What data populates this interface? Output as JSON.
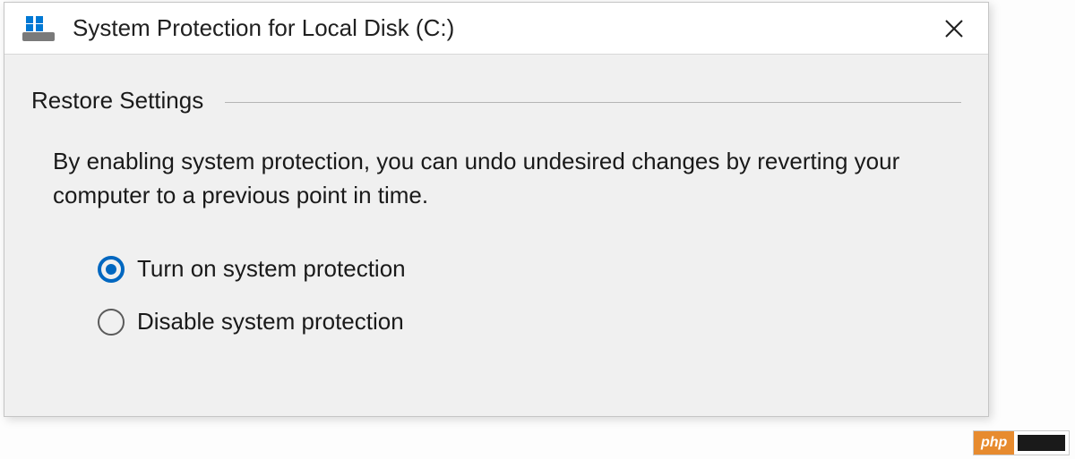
{
  "window": {
    "title": "System Protection for Local Disk (C:)"
  },
  "section": {
    "heading": "Restore Settings",
    "description": "By enabling system protection, you can undo undesired changes by reverting your computer to a previous point in time."
  },
  "options": {
    "turn_on": {
      "label": "Turn on system protection",
      "selected": true
    },
    "disable": {
      "label": "Disable system protection",
      "selected": false
    }
  },
  "watermark": {
    "text": "php"
  }
}
